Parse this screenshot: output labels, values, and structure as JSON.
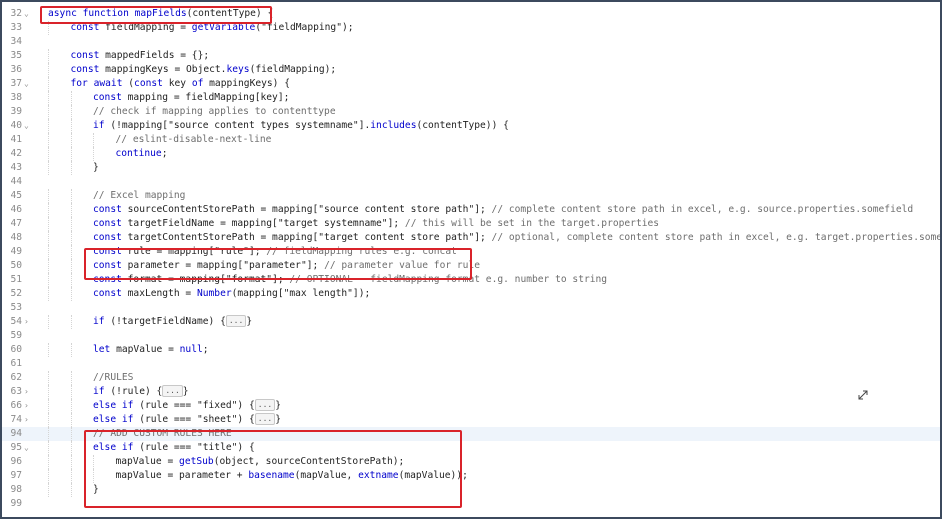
{
  "editor": {
    "lines": [
      {
        "no": "32",
        "fold": "v",
        "indent": 0,
        "tokens": [
          [
            "kw",
            "async "
          ],
          [
            "kw",
            "function "
          ],
          [
            "fn",
            "mapFields"
          ],
          [
            "p",
            "(contentType) {"
          ]
        ]
      },
      {
        "no": "33",
        "fold": "",
        "indent": 1,
        "tokens": [
          [
            "kw",
            "const "
          ],
          [
            "p",
            "fieldMapping = "
          ],
          [
            "fn",
            "getVariable"
          ],
          [
            "p",
            "("
          ],
          [
            "str",
            "\"fieldMapping\""
          ],
          [
            "p",
            ");"
          ]
        ]
      },
      {
        "no": "34",
        "fold": "",
        "indent": 0,
        "tokens": []
      },
      {
        "no": "35",
        "fold": "",
        "indent": 1,
        "tokens": [
          [
            "kw",
            "const "
          ],
          [
            "p",
            "mappedFields = {};"
          ]
        ]
      },
      {
        "no": "36",
        "fold": "",
        "indent": 1,
        "tokens": [
          [
            "kw",
            "const "
          ],
          [
            "p",
            "mappingKeys = Object."
          ],
          [
            "fn",
            "keys"
          ],
          [
            "p",
            "(fieldMapping);"
          ]
        ]
      },
      {
        "no": "37",
        "fold": "v",
        "indent": 1,
        "tokens": [
          [
            "kw",
            "for await "
          ],
          [
            "p",
            "("
          ],
          [
            "kw",
            "const "
          ],
          [
            "p",
            "key "
          ],
          [
            "kw",
            "of "
          ],
          [
            "p",
            "mappingKeys) {"
          ]
        ]
      },
      {
        "no": "38",
        "fold": "",
        "indent": 2,
        "tokens": [
          [
            "kw",
            "const "
          ],
          [
            "p",
            "mapping = fieldMapping[key];"
          ]
        ]
      },
      {
        "no": "39",
        "fold": "",
        "indent": 2,
        "tokens": [
          [
            "cm",
            "// check if mapping applies to contenttype"
          ]
        ]
      },
      {
        "no": "40",
        "fold": "v",
        "indent": 2,
        "tokens": [
          [
            "kw",
            "if "
          ],
          [
            "p",
            "(!mapping["
          ],
          [
            "str",
            "\"source content types systemname\""
          ],
          [
            "p",
            "]."
          ],
          [
            "fn",
            "includes"
          ],
          [
            "p",
            "(contentType)) {"
          ]
        ]
      },
      {
        "no": "41",
        "fold": "",
        "indent": 3,
        "tokens": [
          [
            "cm",
            "// eslint-disable-next-line"
          ]
        ]
      },
      {
        "no": "42",
        "fold": "",
        "indent": 3,
        "tokens": [
          [
            "kw",
            "continue"
          ],
          [
            "p",
            ";"
          ]
        ]
      },
      {
        "no": "43",
        "fold": "",
        "indent": 2,
        "tokens": [
          [
            "p",
            "}"
          ]
        ]
      },
      {
        "no": "44",
        "fold": "",
        "indent": 0,
        "tokens": []
      },
      {
        "no": "45",
        "fold": "",
        "indent": 2,
        "tokens": [
          [
            "cm",
            "// Excel mapping"
          ]
        ]
      },
      {
        "no": "46",
        "fold": "",
        "indent": 2,
        "tokens": [
          [
            "kw",
            "const "
          ],
          [
            "p",
            "sourceContentStorePath = mapping["
          ],
          [
            "str",
            "\"source content store path\""
          ],
          [
            "p",
            "]; "
          ],
          [
            "cm",
            "// complete content store path in excel, e.g. source.properties.somefield"
          ]
        ]
      },
      {
        "no": "47",
        "fold": "",
        "indent": 2,
        "tokens": [
          [
            "kw",
            "const "
          ],
          [
            "p",
            "targetFieldName = mapping["
          ],
          [
            "str",
            "\"target systemname\""
          ],
          [
            "p",
            "]; "
          ],
          [
            "cm",
            "// this will be set in the target.properties"
          ]
        ]
      },
      {
        "no": "48",
        "fold": "",
        "indent": 2,
        "tokens": [
          [
            "kw",
            "const "
          ],
          [
            "p",
            "targetContentStorePath = mapping["
          ],
          [
            "str",
            "\"target content store path\""
          ],
          [
            "p",
            "]; "
          ],
          [
            "cm",
            "// optional, complete content store path in excel, e.g. target.properties.somefield"
          ]
        ]
      },
      {
        "no": "49",
        "fold": "",
        "indent": 2,
        "tokens": [
          [
            "kw",
            "const "
          ],
          [
            "p",
            "rule = mapping["
          ],
          [
            "str",
            "\"rule\""
          ],
          [
            "p",
            "]; "
          ],
          [
            "cm",
            "// fieldMapping rules e.g. concat"
          ]
        ]
      },
      {
        "no": "50",
        "fold": "",
        "indent": 2,
        "tokens": [
          [
            "kw",
            "const "
          ],
          [
            "p",
            "parameter = mapping["
          ],
          [
            "str",
            "\"parameter\""
          ],
          [
            "p",
            "]; "
          ],
          [
            "cm",
            "// parameter value for rule"
          ]
        ]
      },
      {
        "no": "51",
        "fold": "",
        "indent": 2,
        "tokens": [
          [
            "kw",
            "const "
          ],
          [
            "p",
            "format = mapping["
          ],
          [
            "str",
            "\"format\""
          ],
          [
            "p",
            "]; "
          ],
          [
            "cm",
            "// OPTIONAL - fieldMapping format e.g. number to string"
          ]
        ]
      },
      {
        "no": "52",
        "fold": "",
        "indent": 2,
        "tokens": [
          [
            "kw",
            "const "
          ],
          [
            "p",
            "maxLength = "
          ],
          [
            "fn",
            "Number"
          ],
          [
            "p",
            "(mapping["
          ],
          [
            "str",
            "\"max length\""
          ],
          [
            "p",
            "]);"
          ]
        ]
      },
      {
        "no": "53",
        "fold": "",
        "indent": 0,
        "tokens": []
      },
      {
        "no": "54",
        "fold": ">",
        "indent": 2,
        "tokens": [
          [
            "kw",
            "if "
          ],
          [
            "p",
            "(!targetFieldName) {"
          ],
          [
            "box",
            "..."
          ],
          [
            "p",
            "}"
          ]
        ]
      },
      {
        "no": "59",
        "fold": "",
        "indent": 0,
        "tokens": []
      },
      {
        "no": "60",
        "fold": "",
        "indent": 2,
        "tokens": [
          [
            "kw",
            "let "
          ],
          [
            "p",
            "mapValue = "
          ],
          [
            "kw",
            "null"
          ],
          [
            "p",
            ";"
          ]
        ]
      },
      {
        "no": "61",
        "fold": "",
        "indent": 0,
        "tokens": []
      },
      {
        "no": "62",
        "fold": "",
        "indent": 2,
        "tokens": [
          [
            "cm",
            "//RULES"
          ]
        ]
      },
      {
        "no": "63",
        "fold": ">",
        "indent": 2,
        "tokens": [
          [
            "kw",
            "if "
          ],
          [
            "p",
            "(!rule) {"
          ],
          [
            "box",
            "..."
          ],
          [
            "p",
            "}"
          ]
        ]
      },
      {
        "no": "66",
        "fold": ">",
        "indent": 2,
        "tokens": [
          [
            "kw",
            "else if "
          ],
          [
            "p",
            "(rule === "
          ],
          [
            "str",
            "\"fixed\""
          ],
          [
            "p",
            ") {"
          ],
          [
            "box",
            "..."
          ],
          [
            "p",
            "}"
          ]
        ]
      },
      {
        "no": "74",
        "fold": ">",
        "indent": 2,
        "tokens": [
          [
            "kw",
            "else if "
          ],
          [
            "p",
            "(rule === "
          ],
          [
            "str",
            "\"sheet\""
          ],
          [
            "p",
            ") {"
          ],
          [
            "box",
            "..."
          ],
          [
            "p",
            "}"
          ]
        ]
      },
      {
        "no": "94",
        "fold": "",
        "indent": 2,
        "active": true,
        "tokens": [
          [
            "cm",
            "// ADD CUSTOM RULES HERE"
          ]
        ]
      },
      {
        "no": "95",
        "fold": "v",
        "indent": 2,
        "tokens": [
          [
            "kw",
            "else if "
          ],
          [
            "p",
            "(rule === "
          ],
          [
            "str",
            "\"title\""
          ],
          [
            "p",
            ") {"
          ]
        ]
      },
      {
        "no": "96",
        "fold": "",
        "indent": 3,
        "tokens": [
          [
            "p",
            "mapValue = "
          ],
          [
            "fn",
            "getSub"
          ],
          [
            "p",
            "(object, sourceContentStorePath);"
          ]
        ]
      },
      {
        "no": "97",
        "fold": "",
        "indent": 3,
        "tokens": [
          [
            "p",
            "mapValue = parameter + "
          ],
          [
            "fn",
            "basename"
          ],
          [
            "p",
            "(mapValue, "
          ],
          [
            "fn",
            "extname"
          ],
          [
            "p",
            "(mapValue));"
          ]
        ]
      },
      {
        "no": "98",
        "fold": "",
        "indent": 2,
        "tokens": [
          [
            "p",
            "}"
          ]
        ]
      },
      {
        "no": "99",
        "fold": "",
        "indent": 0,
        "tokens": []
      }
    ]
  },
  "colors": {
    "highlight_border": "#d9232a",
    "keyword": "#0000cc",
    "string": "#a31515",
    "comment": "#6e6e6e",
    "frame_border": "#3c4a5e"
  },
  "icons": {
    "fold_open": "chevron-down-icon",
    "fold_closed": "chevron-right-icon",
    "cursor": "resize-cursor-icon"
  }
}
